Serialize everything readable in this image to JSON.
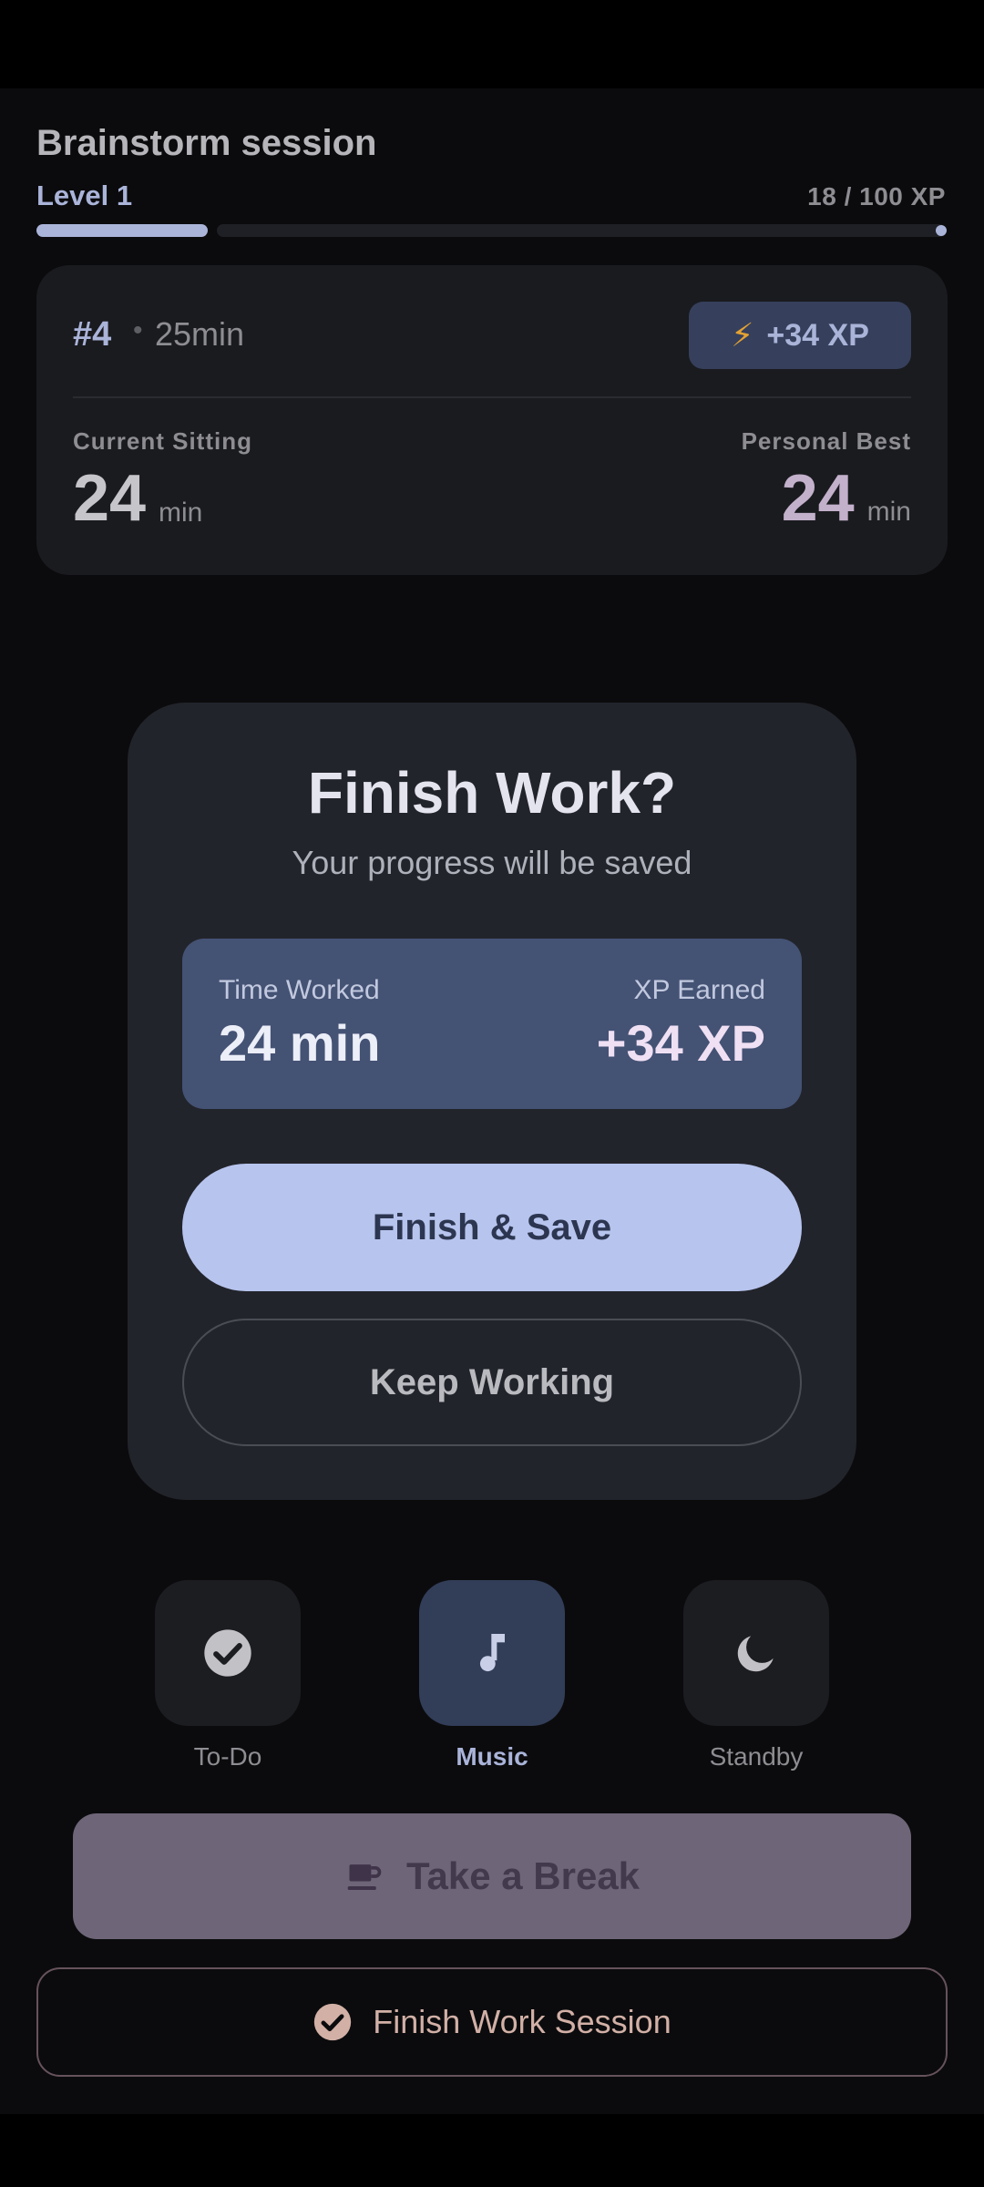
{
  "header": {
    "title": "Brainstorm session",
    "level": "Level 1",
    "xp_progress": "18 / 100 XP",
    "xp_fraction": 0.18,
    "accent_color": "#aab4d9"
  },
  "session_card": {
    "number": "#4",
    "separator": "•",
    "duration": "25min",
    "xp_badge_icon": "lightning-bolt",
    "xp_badge_bolt": "⚡",
    "xp_badge": "+34 XP",
    "current_label": "Current Sitting",
    "current_value": "24",
    "current_unit": "min",
    "best_label": "Personal Best",
    "best_value": "24",
    "best_unit": "min"
  },
  "dialog": {
    "title": "Finish Work?",
    "subtitle": "Your progress will be saved",
    "time_label": "Time Worked",
    "time_value": "24 min",
    "xp_label": "XP Earned",
    "xp_value": "+34 XP",
    "primary_button": "Finish & Save",
    "secondary_button": "Keep Working"
  },
  "tools": [
    {
      "label": "To-Do",
      "icon": "check-circle",
      "active": false
    },
    {
      "label": "Music",
      "icon": "music-note",
      "active": true
    },
    {
      "label": "Standby",
      "icon": "moon",
      "active": false
    }
  ],
  "actions": {
    "break_icon": "coffee-cup",
    "break_label": "Take a Break",
    "finish_icon": "check-circle",
    "finish_label": "Finish Work Session"
  }
}
